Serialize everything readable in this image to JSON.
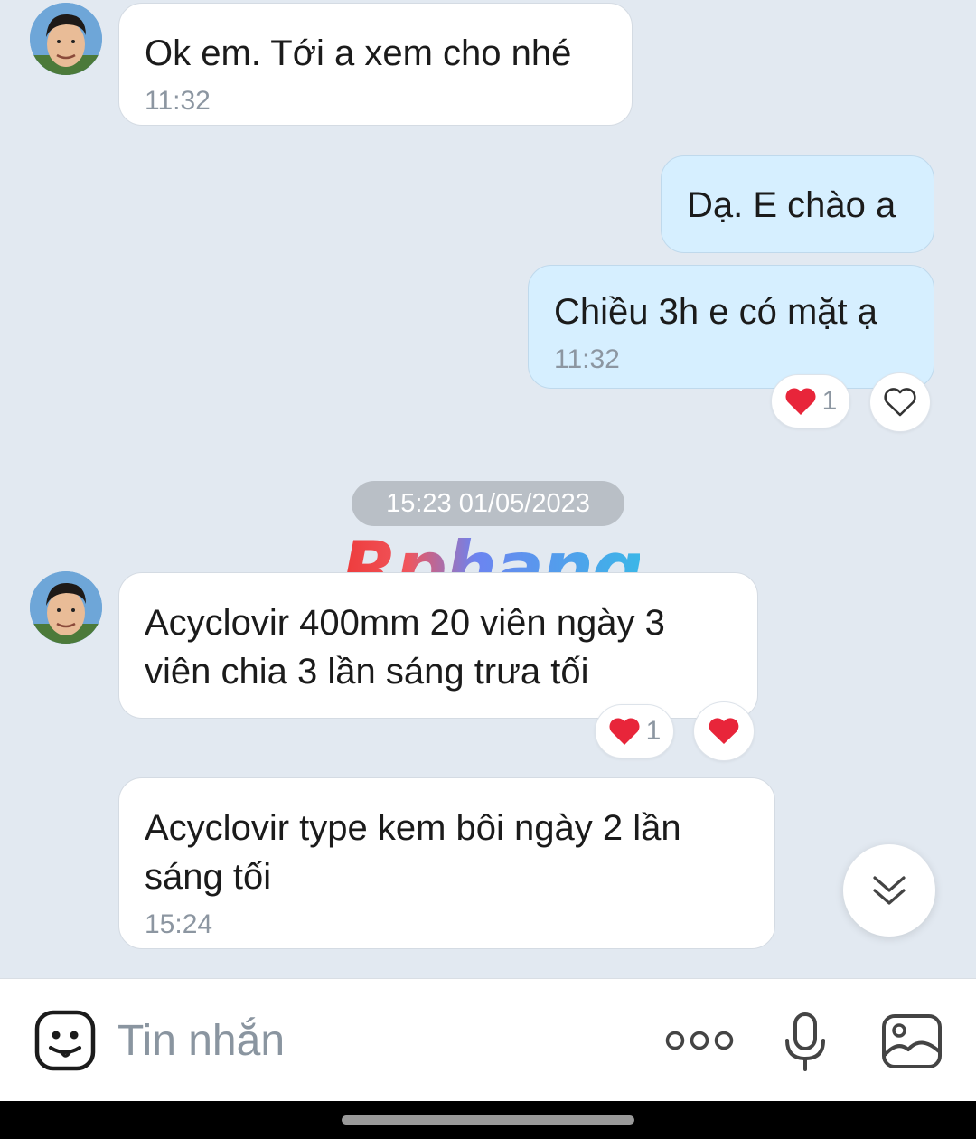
{
  "colors": {
    "background": "#e2e9f1",
    "incoming_bubble": "#ffffff",
    "outgoing_bubble": "#d6efff",
    "heart_red": "#e8253a",
    "timestamp_gray": "#8c96a1"
  },
  "messages": [
    {
      "id": "m1",
      "direction": "incoming",
      "text": "Ok em. Tới a xem cho nhé",
      "time": "11:32"
    },
    {
      "id": "m2",
      "direction": "outgoing",
      "text": "Dạ. E chào a"
    },
    {
      "id": "m3",
      "direction": "outgoing",
      "text": "Chiều 3h e có mặt ạ",
      "time": "11:32",
      "reactions": {
        "heart_count": "1"
      }
    },
    {
      "id": "m4",
      "direction": "incoming",
      "text": "Acyclovir 400mm 20 viên ngày 3 viên chia 3 lần sáng trưa tối",
      "reactions": {
        "heart_count": "1"
      }
    },
    {
      "id": "m5",
      "direction": "incoming",
      "text": "Acyclovir type kem bôi ngày 2 lần sáng tối",
      "time": "15:24"
    }
  ],
  "date_separator": "15:23 01/05/2023",
  "watermark": "Rphang",
  "composer": {
    "placeholder": "Tin nhắn",
    "icons": [
      "sticker-icon",
      "more-icon",
      "microphone-icon",
      "image-icon"
    ]
  },
  "scroll_button_icon": "double-chevron-down-icon"
}
